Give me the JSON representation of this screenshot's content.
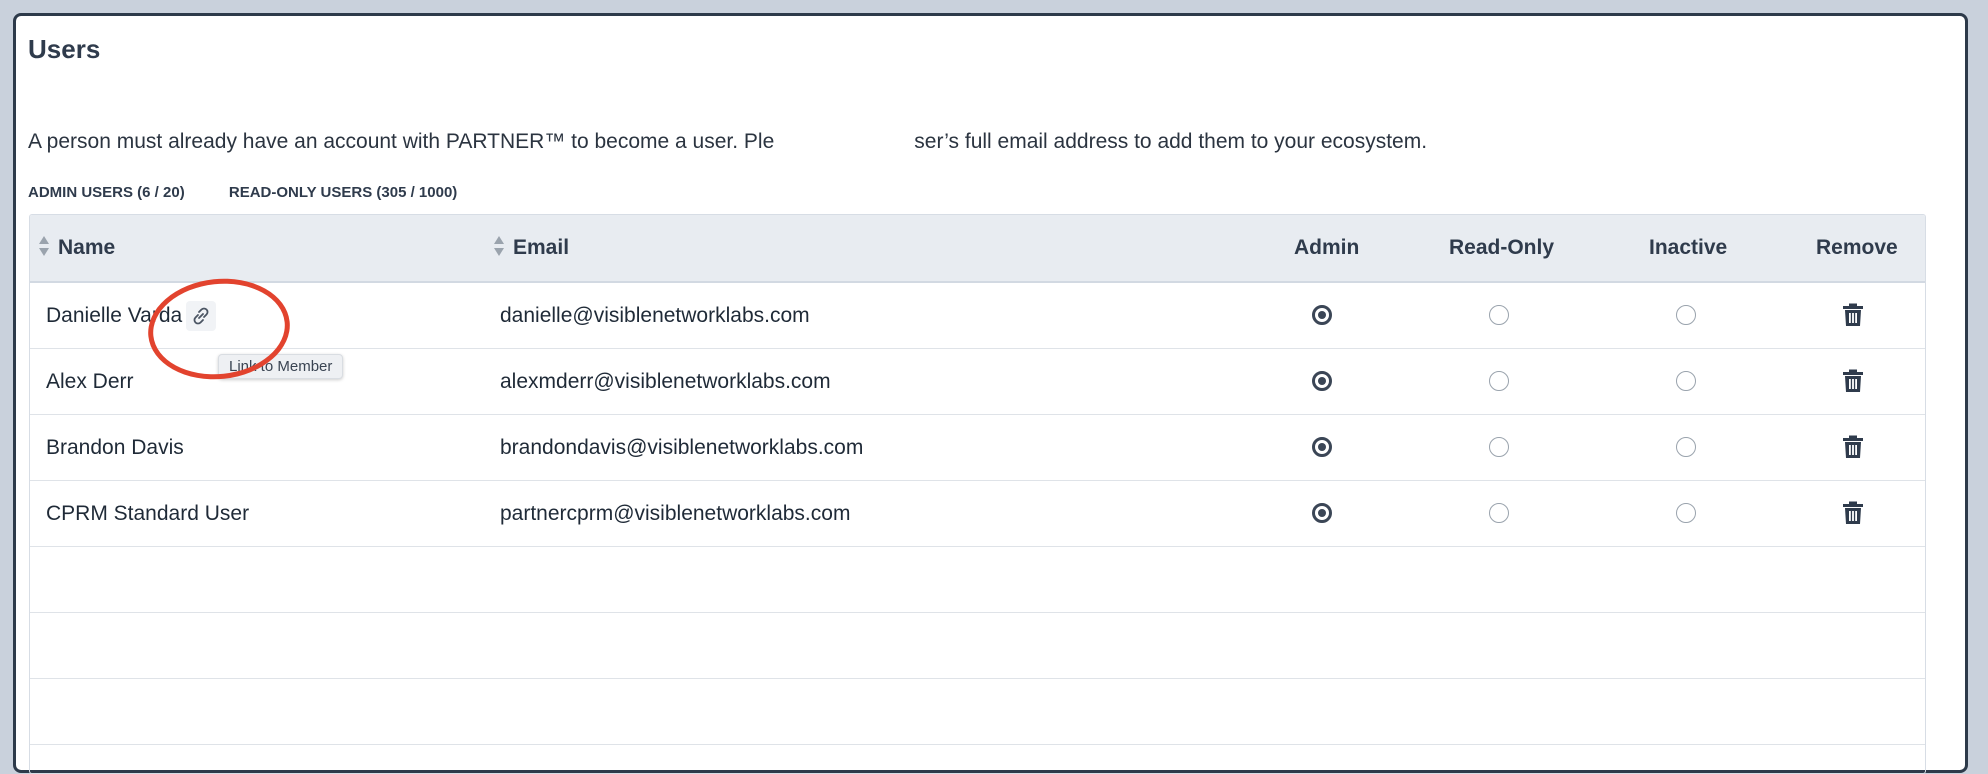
{
  "page": {
    "title": "Users",
    "description_part1": "A person must already have an account with PARTNER™ to become a user. Ple",
    "description_part2": "ser’s full email address to add them to your ecosystem.",
    "admin_count": "ADMIN USERS (6 / 20)",
    "readonly_count": "READ-ONLY USERS (305 / 1000)"
  },
  "table": {
    "columns": {
      "name": "Name",
      "email": "Email",
      "admin": "Admin",
      "readonly": "Read-Only",
      "inactive": "Inactive",
      "remove": "Remove"
    },
    "rows": [
      {
        "name": "Danielle Varda",
        "email": "danielle@visiblenetworklabs.com",
        "role": "admin"
      },
      {
        "name": "Alex Derr",
        "email": "alexmderr@visiblenetworklabs.com",
        "role": "admin"
      },
      {
        "name": "Brandon Davis",
        "email": "brandondavis@visiblenetworklabs.com",
        "role": "admin"
      },
      {
        "name": "CPRM Standard User",
        "email": "partnercprm@visiblenetworklabs.com",
        "role": "admin"
      }
    ]
  },
  "tooltip": {
    "text": "Link to Member"
  },
  "colors": {
    "annotation_ring": "#e2432e",
    "header_bg": "#e8ecf1",
    "radio_selected": "#3b4656"
  }
}
